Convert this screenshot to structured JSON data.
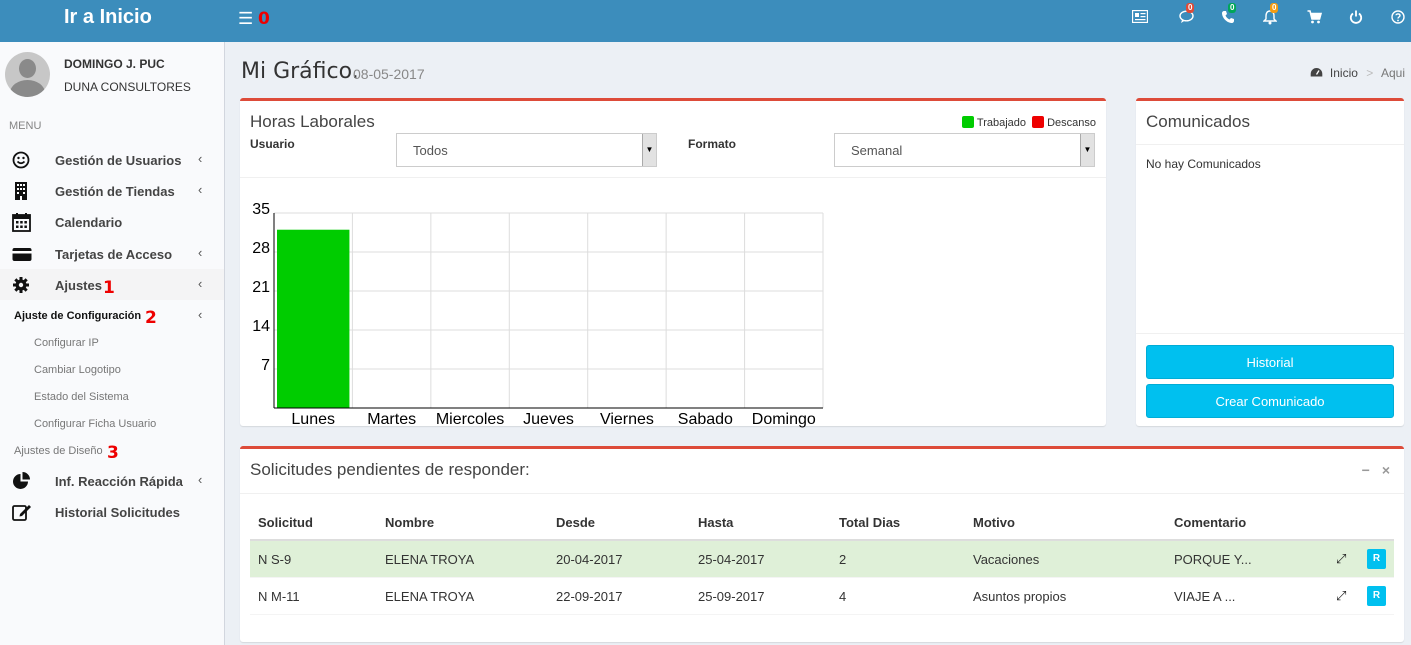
{
  "header": {
    "logo": "Ir a Inicio",
    "menu_icon": "menu-icon",
    "annotation": "0",
    "icons": [
      {
        "name": "newspaper-icon",
        "glyph": "▤",
        "badge": null
      },
      {
        "name": "chat-icon",
        "glyph": "💬",
        "badge": "0",
        "badge_color": "#dd4b39"
      },
      {
        "name": "phone-icon",
        "glyph": "☎",
        "badge": "0",
        "badge_color": "#00a65a"
      },
      {
        "name": "bell-icon",
        "glyph": "🔔",
        "badge": "0",
        "badge_color": "#f39c12"
      },
      {
        "name": "cart-icon",
        "glyph": "🛒",
        "badge": null
      },
      {
        "name": "power-icon",
        "glyph": "⏻",
        "badge": null
      },
      {
        "name": "help-icon",
        "glyph": "?",
        "badge": null
      }
    ]
  },
  "sidebar": {
    "user_name": "DOMINGO J. PUC",
    "user_company": "DUNA CONSULTORES",
    "menu_header": "MENU",
    "items": [
      {
        "label": "Gestión de Usuarios",
        "icon": "smile-icon",
        "chevron": "‹"
      },
      {
        "label": "Gestión de Tiendas",
        "icon": "building-icon",
        "chevron": "‹"
      },
      {
        "label": "Calendario",
        "icon": "calendar-icon",
        "chevron": ""
      },
      {
        "label": "Tarjetas de Acceso",
        "icon": "credit-card-icon",
        "chevron": "‹"
      },
      {
        "label": "Ajustes",
        "icon": "gear-icon",
        "chevron": "‹",
        "annotation": "1"
      },
      {
        "label": "Inf. Reacción Rápida",
        "icon": "pie-chart-icon",
        "chevron": "‹"
      },
      {
        "label": "Historial Solicitudes",
        "icon": "edit-icon",
        "chevron": ""
      }
    ],
    "sub": {
      "config_label": "Ajuste de Configuración",
      "config_annotation": "2",
      "config_items": [
        "Configurar IP",
        "Cambiar Logotipo",
        "Estado del Sistema",
        "Configurar Ficha Usuario"
      ],
      "design_label": "Ajustes de Diseño",
      "design_annotation": "3"
    }
  },
  "page": {
    "title": "Mi Gráfico.",
    "date": "08-05-2017",
    "breadcrumb": [
      "Inicio",
      "Aqui"
    ],
    "breadcrumb_sep": ">"
  },
  "chart_box": {
    "title": "Horas Laborales",
    "usuario_label": "Usuario",
    "usuario_value": "Todos",
    "formato_label": "Formato",
    "formato_value": "Semanal",
    "legend": [
      {
        "label": "Trabajado",
        "color": "#00cc00"
      },
      {
        "label": "Descanso",
        "color": "#ee0000"
      }
    ]
  },
  "chart_data": {
    "type": "bar",
    "categories": [
      "Lunes",
      "Martes",
      "Miercoles",
      "Jueves",
      "Viernes",
      "Sabado",
      "Domingo"
    ],
    "series": [
      {
        "name": "Trabajado",
        "values": [
          32,
          0,
          0,
          0,
          0,
          0,
          0
        ],
        "color": "#00cc00"
      },
      {
        "name": "Descanso",
        "values": [
          0,
          0,
          0,
          0,
          0,
          0,
          0
        ],
        "color": "#ee0000"
      }
    ],
    "yticks": [
      7,
      14,
      21,
      28,
      35
    ],
    "ylim": [
      0,
      35
    ],
    "grid": true,
    "legend_position": "top-right"
  },
  "comunicados": {
    "title": "Comunicados",
    "empty_text": "No hay Comunicados",
    "historial_button": "Historial",
    "crear_button": "Crear Comunicado"
  },
  "solicitudes": {
    "title": "Solicitudes pendientes de responder:",
    "tools": [
      "−",
      "×"
    ],
    "columns": [
      "Solicitud",
      "Nombre",
      "Desde",
      "Hasta",
      "Total Dias",
      "Motivo",
      "Comentario"
    ],
    "rows": [
      {
        "solicitud": "N S-9",
        "nombre": "ELENA TROYA",
        "desde": "20-04-2017",
        "hasta": "25-04-2017",
        "total": "2",
        "motivo": "Vacaciones",
        "comentario": "PORQUE Y...",
        "action": "R"
      },
      {
        "solicitud": "N M-11",
        "nombre": "ELENA TROYA",
        "desde": "22-09-2017",
        "hasta": "25-09-2017",
        "total": "4",
        "motivo": "Asuntos propios",
        "comentario": "VIAJE A ...",
        "action": "R"
      }
    ]
  }
}
